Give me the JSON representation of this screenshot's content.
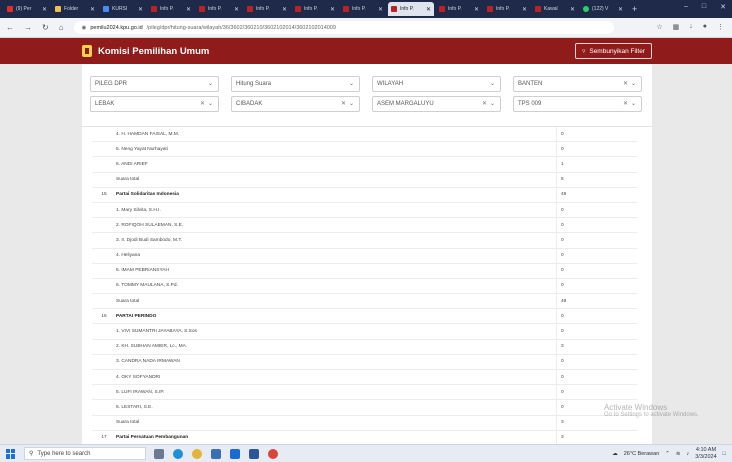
{
  "browser": {
    "tabs": [
      {
        "label": "(9) Per",
        "icon": "youtube-icon",
        "kind": "yt",
        "active": false
      },
      {
        "label": "Folder",
        "icon": "folder-icon",
        "kind": "folder",
        "active": false
      },
      {
        "label": "KURSI",
        "icon": "globe-icon",
        "kind": "gm",
        "active": false
      },
      {
        "label": "Info P.",
        "icon": "kpu-icon",
        "kind": "kpu",
        "active": false
      },
      {
        "label": "Info P.",
        "icon": "kpu-icon",
        "kind": "kpu",
        "active": false
      },
      {
        "label": "Info P.",
        "icon": "kpu-icon",
        "kind": "kpu",
        "active": false
      },
      {
        "label": "Info P.",
        "icon": "kpu-icon",
        "kind": "kpu",
        "active": false
      },
      {
        "label": "Info P.",
        "icon": "kpu-icon",
        "kind": "kpu",
        "active": false
      },
      {
        "label": "Info P.",
        "icon": "kpu-icon",
        "kind": "kpu",
        "active": true
      },
      {
        "label": "Info P.",
        "icon": "kpu-icon",
        "kind": "kpu",
        "active": false
      },
      {
        "label": "Info P.",
        "icon": "kpu-icon",
        "kind": "kpu",
        "active": false
      },
      {
        "label": "Kawal",
        "icon": "kawal-icon",
        "kind": "kpu",
        "active": false
      },
      {
        "label": "(122) V",
        "icon": "whatsapp-icon",
        "kind": "wa",
        "active": false
      }
    ],
    "url_host": "pemilu2024.kpu.go.id",
    "url_path": "/pileg/dpr/hitung-suara/wilayah/36/3602/360210/3602102014/3602102014009"
  },
  "header": {
    "title": "Komisi Pemilihan Umum",
    "hide_filter_label": "Sembunyikan Filter"
  },
  "filters": {
    "row1": [
      "PILEG DPR",
      "Hitung Suara",
      "WILAYAH",
      "BANTEN"
    ],
    "row2": [
      "LEBAK",
      "CIBADAK",
      "ASEM MARGALUYU",
      "TPS 009"
    ]
  },
  "table": {
    "rows": [
      {
        "no": "",
        "name": "4. H. HAMDAN FAISAL, M.M.",
        "votes": "0",
        "party": false
      },
      {
        "no": "",
        "name": "5. Neng Yayat Nurhayati",
        "votes": "0",
        "party": false
      },
      {
        "no": "",
        "name": "6. ANDI ARIEF",
        "votes": "1",
        "party": false
      },
      {
        "no": "",
        "name": "Suara total",
        "votes": "5",
        "party": false
      },
      {
        "no": "15",
        "name": "Partai Solidaritas Indonesia",
        "votes": "49",
        "party": true
      },
      {
        "no": "",
        "name": "1. Mary Silvita, S.H.I.",
        "votes": "0",
        "party": false
      },
      {
        "no": "",
        "name": "2. ROFIQOH SULAEMAN, S.E.",
        "votes": "0",
        "party": false
      },
      {
        "no": "",
        "name": "3. Ir. Djodi Budi Sambodo, M.T.",
        "votes": "0",
        "party": false
      },
      {
        "no": "",
        "name": "4. Heliyana",
        "votes": "0",
        "party": false
      },
      {
        "no": "",
        "name": "5. IMAM PEBRIANSYAH",
        "votes": "0",
        "party": false
      },
      {
        "no": "",
        "name": "6. TOMMY MAULANA, S.Pd.",
        "votes": "0",
        "party": false
      },
      {
        "no": "",
        "name": "Suara total",
        "votes": "49",
        "party": false
      },
      {
        "no": "16",
        "name": "PARTAI PERINDO",
        "votes": "0",
        "party": true
      },
      {
        "no": "",
        "name": "1. VIVI SUMANTRI JAYABAYA, S.Sos",
        "votes": "0",
        "party": false
      },
      {
        "no": "",
        "name": "2. KH. SUBHAN AMIER, Lc., MA.",
        "votes": "3",
        "party": false
      },
      {
        "no": "",
        "name": "3. CANDRA NADA IRMAWAN",
        "votes": "0",
        "party": false
      },
      {
        "no": "",
        "name": "4. OKY SOFYANDRI",
        "votes": "0",
        "party": false
      },
      {
        "no": "",
        "name": "5. LUFI IRAWAN, S.IP.",
        "votes": "0",
        "party": false
      },
      {
        "no": "",
        "name": "6. LESTARI, S.E.",
        "votes": "0",
        "party": false
      },
      {
        "no": "",
        "name": "Suara total",
        "votes": "3",
        "party": false
      },
      {
        "no": "17",
        "name": "Partai Persatuan Pembangunan",
        "votes": "3",
        "party": true
      }
    ]
  },
  "watermark": {
    "line1": "Activate Windows",
    "line2": "Go to Settings to activate Windows."
  },
  "taskbar": {
    "search_placeholder": "Type here to search",
    "weather": "26°C  Berawan",
    "time": "4:10 AM",
    "date": "3/3/2024"
  }
}
